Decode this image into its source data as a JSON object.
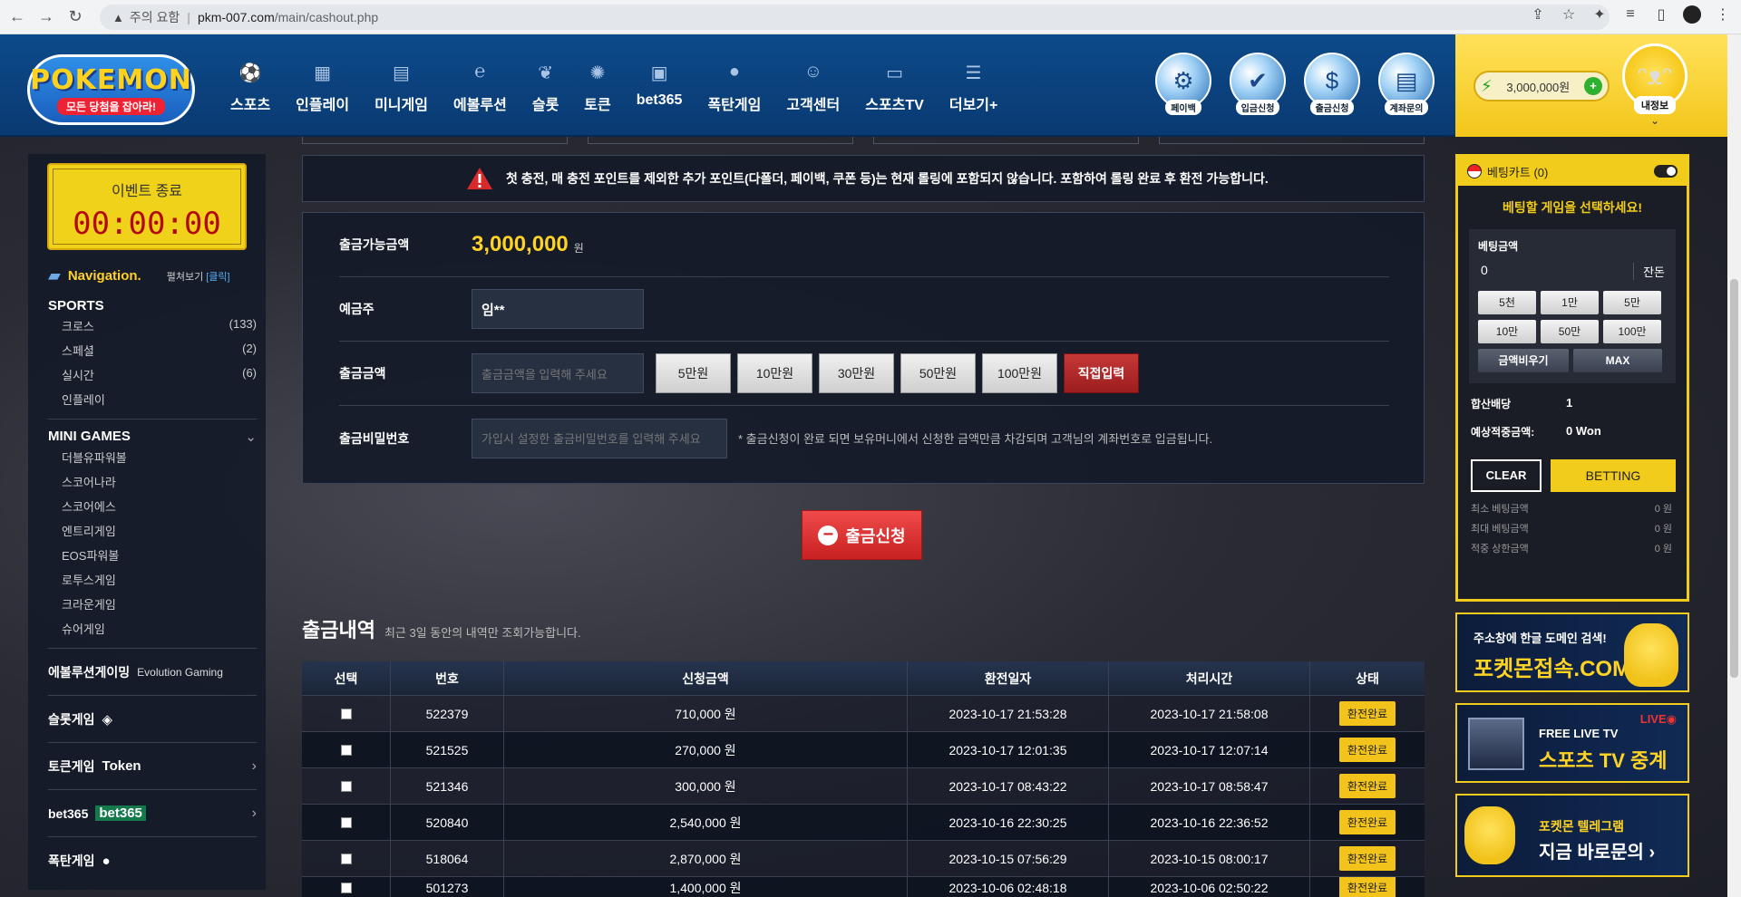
{
  "browser": {
    "security": "주의 요함",
    "host": "pkm-007.com",
    "path": "/main/cashout.php"
  },
  "header": {
    "logo_text": "POKEMON",
    "logo_tagline": "모든 당첨을 잡아라!",
    "nav": [
      {
        "label": "스포츠",
        "icon": "soccer-ball-icon"
      },
      {
        "label": "인플레이",
        "icon": "film-icon"
      },
      {
        "label": "미니게임",
        "icon": "ladder-icon"
      },
      {
        "label": "에볼루션",
        "icon": "evolution-icon"
      },
      {
        "label": "슬롯",
        "icon": "cherry-icon"
      },
      {
        "label": "토큰",
        "icon": "token-icon"
      },
      {
        "label": "bet365",
        "icon": "bet365-icon"
      },
      {
        "label": "폭탄게임",
        "icon": "bomb-icon"
      },
      {
        "label": "고객센터",
        "icon": "headset-icon"
      },
      {
        "label": "스포츠TV",
        "icon": "tv-icon"
      },
      {
        "label": "더보기+",
        "icon": "list-icon"
      }
    ],
    "quick": [
      {
        "label": "페이백",
        "icon": "gear-icon"
      },
      {
        "label": "입금신청",
        "icon": "checklist-icon"
      },
      {
        "label": "출금신청",
        "icon": "money-bag-icon"
      },
      {
        "label": "계좌문의",
        "icon": "card-icon"
      }
    ],
    "balance": "3,000,000원",
    "mypage": "내정보"
  },
  "sidebar": {
    "event_title": "이벤트 종료",
    "event_timer": "00:00:00",
    "nav_title": "Navigation.",
    "fold_text": "펼쳐보기",
    "fold_link": "[클릭]",
    "sports": {
      "title": "SPORTS",
      "items": [
        {
          "label": "크로스",
          "count": "(133)"
        },
        {
          "label": "스페셜",
          "count": "(2)"
        },
        {
          "label": "실시간",
          "count": "(6)"
        },
        {
          "label": "인플레이",
          "count": ""
        }
      ]
    },
    "mini": {
      "title": "MINI GAMES",
      "items": [
        "더블유파워볼",
        "스코어나라",
        "스코어에스",
        "엔트리게임",
        "EOS파워볼",
        "로투스게임",
        "크라운게임",
        "슈어게임"
      ]
    },
    "links": [
      {
        "label": "에볼루션게이밍",
        "extra": "Evolution Gaming"
      },
      {
        "label": "슬롯게임",
        "extra": ""
      },
      {
        "label": "토큰게임",
        "extra": "Token"
      },
      {
        "label": "bet365",
        "extra": "bet365"
      },
      {
        "label": "폭탄게임",
        "extra": ""
      }
    ]
  },
  "main": {
    "notice": "첫 충전, 매 충전 포인트를 제외한 추가 포인트(다폴더, 페이백, 쿠폰 등)는 현재 롤링에 포함되지 않습니다. 포함하여 롤링 완료 후 환전 가능합니다.",
    "available_label": "출금가능금액",
    "available_value": "3,000,000",
    "won": "원",
    "holder_label": "예금주",
    "holder_value": "임**",
    "amount_label": "출금금액",
    "amount_placeholder": "출금금액을 입력해 주세요",
    "amount_buttons": [
      "5만원",
      "10만원",
      "30만원",
      "50만원",
      "100만원"
    ],
    "direct_button": "직접입력",
    "pw_label": "출금비밀번호",
    "pw_placeholder": "가입시 설정한 출금비밀번호를 입력해 주세요",
    "pw_note": "* 출금신청이 완료 되면 보유머니에서 신청한 금액만큼 차감되며 고객님의 계좌번호로 입금됩니다.",
    "submit": "출금신청",
    "history_title": "출금내역",
    "history_sub": "최근 3일 동안의 내역만 조회가능합니다.",
    "columns": [
      "선택",
      "번호",
      "신청금액",
      "환전일자",
      "처리시간",
      "상태"
    ],
    "rows": [
      {
        "id": "522379",
        "amount": "710,000 원",
        "date": "2023-10-17 21:53:28",
        "done": "2023-10-17 21:58:08",
        "status": "환전완료"
      },
      {
        "id": "521525",
        "amount": "270,000 원",
        "date": "2023-10-17 12:01:35",
        "done": "2023-10-17 12:07:14",
        "status": "환전완료"
      },
      {
        "id": "521346",
        "amount": "300,000 원",
        "date": "2023-10-17 08:43:22",
        "done": "2023-10-17 08:58:47",
        "status": "환전완료"
      },
      {
        "id": "520840",
        "amount": "2,540,000 원",
        "date": "2023-10-16 22:30:25",
        "done": "2023-10-16 22:36:52",
        "status": "환전완료"
      },
      {
        "id": "518064",
        "amount": "2,870,000 원",
        "date": "2023-10-15 07:56:29",
        "done": "2023-10-15 08:00:17",
        "status": "환전완료"
      },
      {
        "id": "501273",
        "amount": "1,400,000 원",
        "date": "2023-10-06 02:48:18",
        "done": "2023-10-06 02:50:22",
        "status": "환전완료"
      }
    ]
  },
  "slip": {
    "title": "베팅카트 (0)",
    "select_msg": "베팅할 게임을 선택하세요!",
    "amount_label": "베팅금액",
    "amount_value": "0",
    "balance": "잔돈",
    "buttons": [
      "5천",
      "1만",
      "5만",
      "10만",
      "50만",
      "100만"
    ],
    "clear_amount": "금액비우기",
    "max": "MAX",
    "odds_label": "합산배당",
    "odds_value": "1",
    "win_label": "예상적중금액:",
    "win_value": "0 Won",
    "clear": "CLEAR",
    "betting": "BETTING",
    "limits": [
      {
        "label": "최소 베팅금액",
        "value": "0 원"
      },
      {
        "label": "최대 베팅금액",
        "value": "0 원"
      },
      {
        "label": "적중 상한금액",
        "value": "0 원"
      }
    ]
  },
  "banners": {
    "b1_line1": "주소창에 한글 도메인 검색!",
    "b1_line2": "포켓몬접속.COM",
    "b2_live": "LIVE◉",
    "b2_line1": "FREE LIVE TV",
    "b2_line2": "스포츠 TV 중계",
    "b3_line1": "포켓몬 텔레그램",
    "b3_line2": "지금 바로문의 ›"
  }
}
